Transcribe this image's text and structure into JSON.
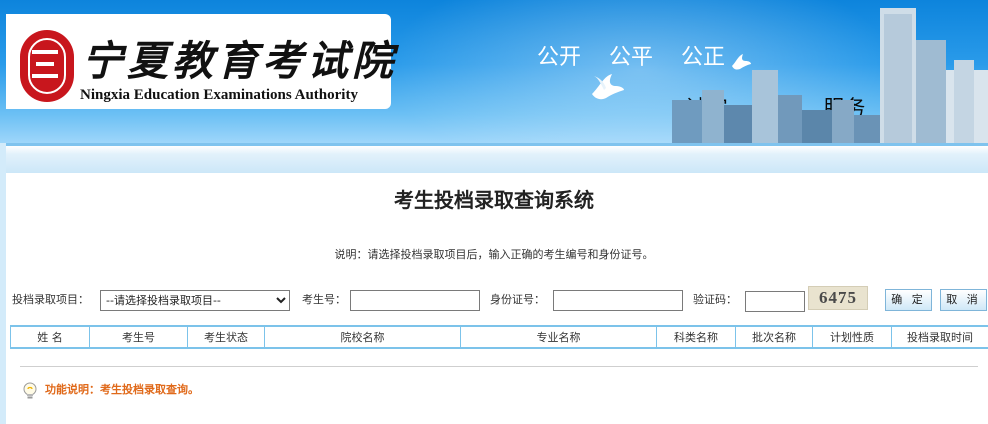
{
  "header": {
    "org_name_cn": "宁夏教育考试院",
    "org_name_en": "Ningxia Education Examinations Authority",
    "slogan_line1": "公开    公平    公正",
    "slogan_line2": "诚实    高效    服务"
  },
  "main": {
    "title": "考生投档录取查询系统",
    "notice": "说明：请选择投档录取项目后，输入正确的考生编号和身份证号。"
  },
  "form": {
    "project_label": "投档录取项目：",
    "project_selected": "--请选择投档录取项目--",
    "exam_no_label": "考生号：",
    "exam_no_value": "",
    "id_label": "身份证号：",
    "id_value": "",
    "captcha_label": "验证码：",
    "captcha_value": "",
    "captcha_text": "6475",
    "confirm_label": "确 定",
    "cancel_label": "取 消"
  },
  "table": {
    "columns": [
      "姓 名",
      "考生号",
      "考生状态",
      "院校名称",
      "专业名称",
      "科类名称",
      "批次名称",
      "计划性质",
      "投档录取时间"
    ]
  },
  "footer_tip": {
    "text": "功能说明：考生投档录取查询。"
  },
  "colors": {
    "banner_blue": "#0d84dc",
    "seal_red": "#c8161d",
    "table_border": "#7cc3ea",
    "tip_orange": "#e06a1b"
  }
}
